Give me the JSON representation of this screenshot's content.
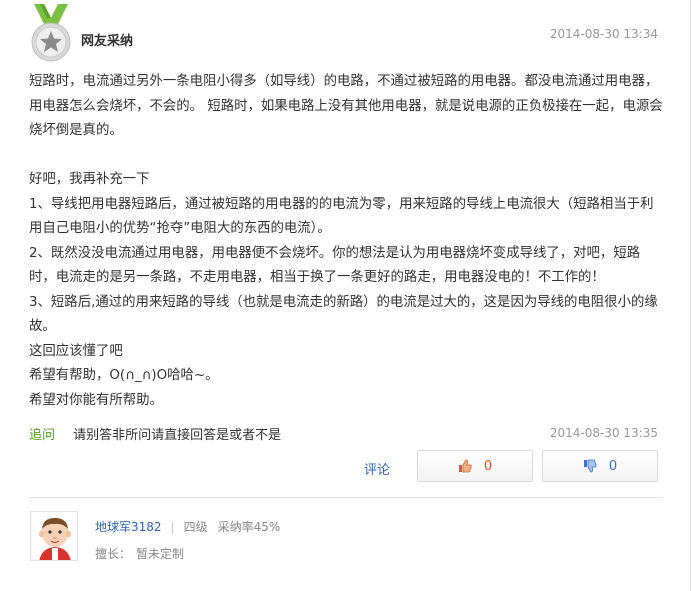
{
  "header": {
    "adopt_label": "网友采纳",
    "timestamp": "2014-08-30 13:34",
    "badge_icon": "medal-star-icon"
  },
  "answer": {
    "paragraphs": [
      "短路时，电流通过另外一条电阻小得多（如导线）的电路，不通过被短路的用电器。都没电流通过用电器，用电器怎么会烧坏，不会的。 短路时，如果电路上没有其他用电器，就是说电源的正负极接在一起，电源会烧坏倒是真的。",
      "",
      "好吧，我再补充一下",
      "1、导线把用电器短路后，通过被短路的用电器的的电流为零，用来短路的导线上电流很大（短路相当于利用自己电阻小的优势“抢夺”电阻大的东西的电流）。",
      "2、既然没没电流通过用电器，用电器便不会烧坏。你的想法是认为用电器烧坏变成导线了，对吧，短路时，电流走的是另一条路，不走用电器，相当于换了一条更好的路走，用电器没电的！不工作的！",
      "3、短路后,通过的用来短路的导线（也就是电流走的新路）的电流是过大的，这是因为导线的电阻很小的缘故。",
      "这回应该懂了吧",
      "希望有帮助，O(∩_∩)O哈哈~。",
      "希望对你能有所帮助。"
    ]
  },
  "followup": {
    "tag": "追问",
    "text": "请别答非所问请直接回答是或者不是",
    "timestamp": "2014-08-30 13:35"
  },
  "actions": {
    "comment_label": "评论",
    "upvote_count": "0",
    "downvote_count": "0",
    "upvote_icon": "thumbs-up-icon",
    "downvote_icon": "thumbs-down-icon"
  },
  "answerer": {
    "name": "地球军3182",
    "level": "四级",
    "adoption_rate": "采纳率45%",
    "skill_label": "擅长：",
    "skill_value": "暂未定制",
    "avatar_icon": "cartoon-avatar-icon"
  },
  "colors": {
    "accent_green": "#4d9e1f",
    "link_blue": "#2d64b3",
    "upvote_red": "#e2542a",
    "muted_gray": "#999999"
  }
}
